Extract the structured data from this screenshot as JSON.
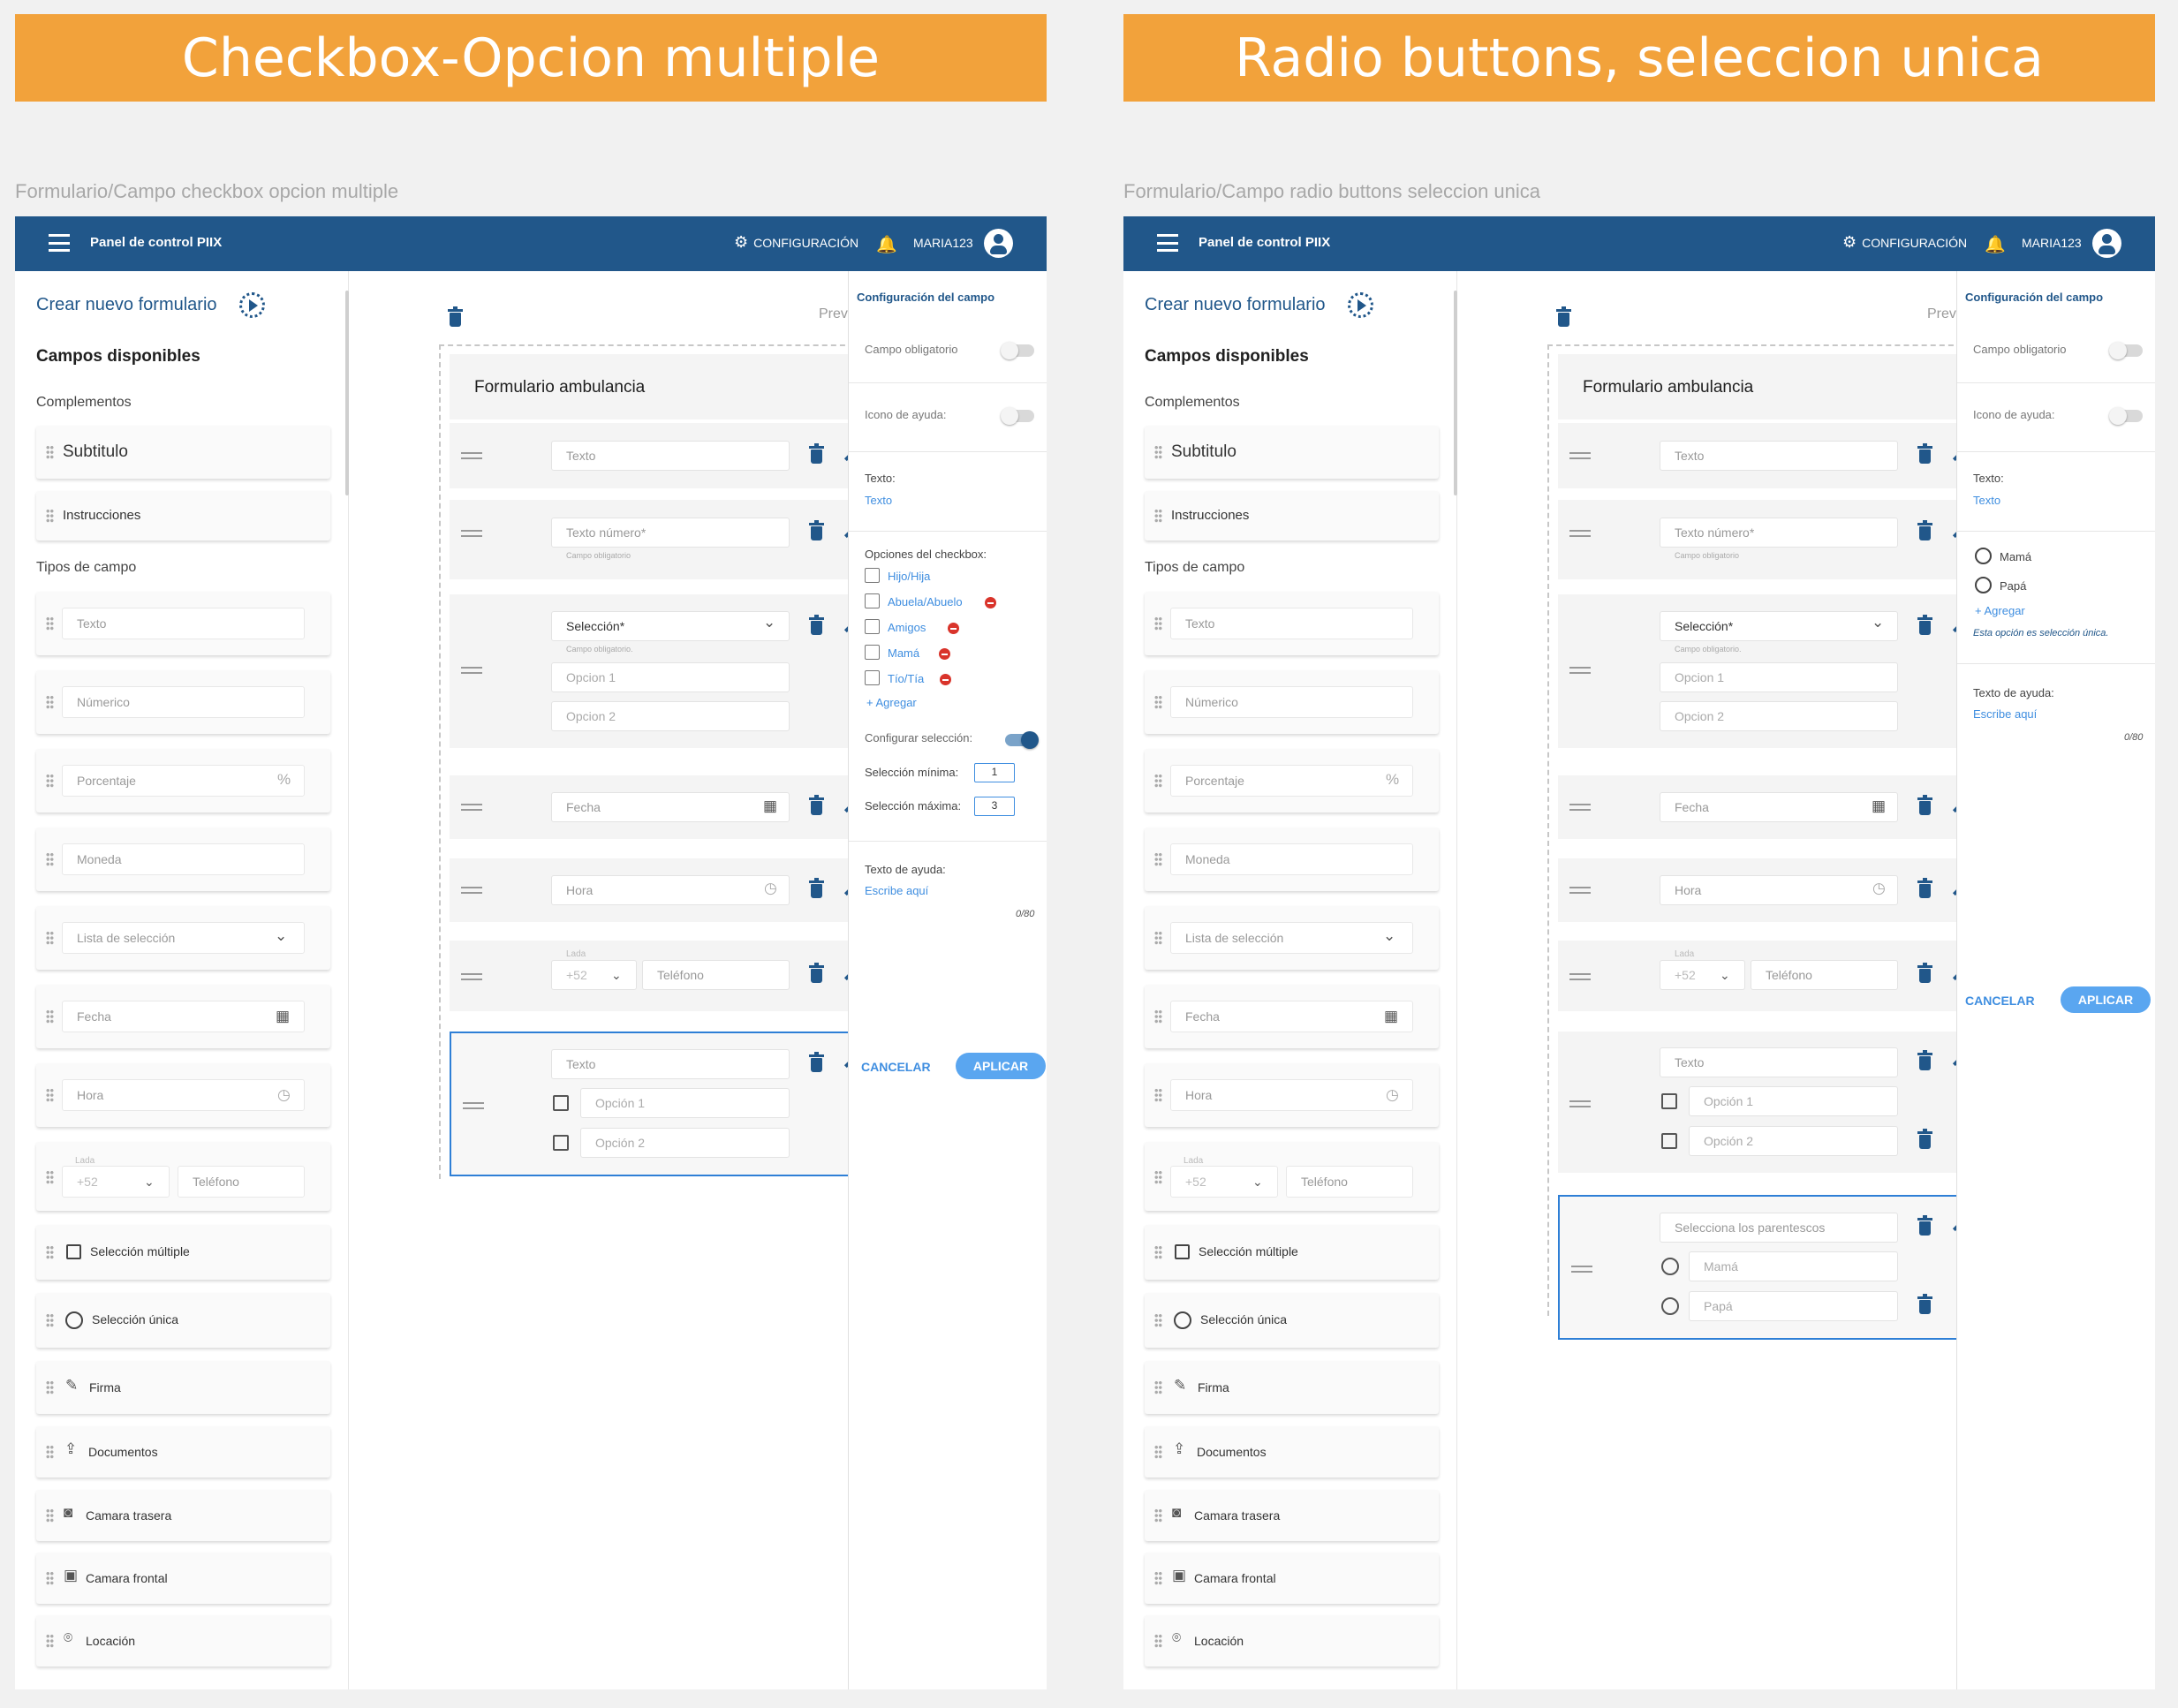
{
  "colors": {
    "banner": "#f2a23b",
    "topbar": "#21578a",
    "accent": "#3f8ee0"
  },
  "panels": [
    {
      "banner": "Checkbox-Opcion multiple",
      "breadcrumb": "Formulario/Campo checkbox opcion multiple"
    },
    {
      "banner": "Radio buttons, seleccion unica",
      "breadcrumb": "Formulario/Campo radio buttons seleccion unica"
    }
  ],
  "topbar": {
    "title": "Panel de control PIIX",
    "config": "CONFIGURACIÓN",
    "user": "MARIA123"
  },
  "sidebar": {
    "create": "Crear nuevo formulario",
    "available": "Campos disponibles",
    "complements": "Complementos",
    "subtitle": "Subtitulo",
    "instructions": "Instrucciones",
    "field_types": "Tipos de campo",
    "texto": "Texto",
    "numerico": "Númerico",
    "porcentaje": "Porcentaje",
    "percent_sign": "%",
    "moneda": "Moneda",
    "lista": "Lista de selección",
    "fecha": "Fecha",
    "hora": "Hora",
    "lada": "Lada",
    "lada_val": "+52",
    "telefono": "Teléfono",
    "multiple": "Selección múltiple",
    "unica": "Selección única",
    "firma": "Firma",
    "documentos": "Documentos",
    "trasera": "Camara trasera",
    "frontal": "Camara frontal",
    "locacion": "Locación"
  },
  "canvas": {
    "preview": "Previs",
    "form_title": "Formulario ambulancia",
    "texto": "Texto",
    "texto_numero": "Texto número*",
    "required": "Campo obligatorio",
    "required2": "Campo obligatorio.",
    "seleccion": "Selección*",
    "opcion1": "Opcion 1",
    "opcion2": "Opcion 2",
    "fecha": "Fecha",
    "hora": "Hora",
    "lada": "Lada",
    "lada_val": "+52",
    "telefono": "Teléfono",
    "op1": "Opción 1",
    "op2": "Opción 2",
    "parentescos": "Selecciona los parentescos",
    "mama": "Mamá",
    "papa": "Papá"
  },
  "config": {
    "title": "Configuración del campo",
    "obligatorio": "Campo obligatorio",
    "icono": "Icono de ayuda:",
    "texto_lbl": "Texto:",
    "texto_val": "Texto",
    "opciones": "Opciones del checkbox:",
    "checks": [
      "Hijo/Hija",
      "Abuela/Abuelo",
      "Amigos",
      "Mamá",
      "Tío/Tía"
    ],
    "agregar": "Agregar",
    "configurar": "Configurar selección:",
    "minima": "Selección mínima:",
    "min_val": "1",
    "maxima": "Selección máxima:",
    "max_val": "3",
    "ayuda": "Texto de ayuda:",
    "escribe": "Escribe aquí",
    "count": "0/80",
    "cancel": "CANCELAR",
    "apply": "APLICAR",
    "radios": [
      "Mamá",
      "Papá"
    ],
    "radio_note": "Esta opción es selección única."
  }
}
